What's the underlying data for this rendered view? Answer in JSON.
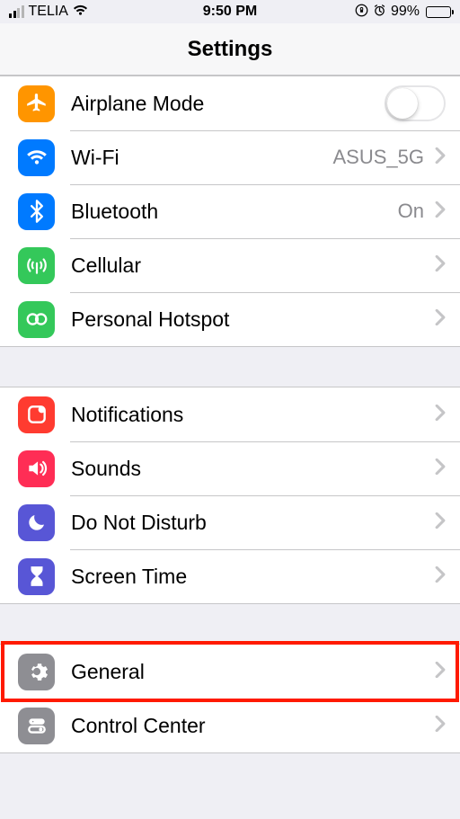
{
  "statusbar": {
    "carrier": "TELIA",
    "time": "9:50 PM",
    "battery_pct": "99%"
  },
  "header": {
    "title": "Settings"
  },
  "groups": [
    {
      "rows": [
        {
          "id": "airplane",
          "label": "Airplane Mode",
          "value": "",
          "toggle": true,
          "chevron": false
        },
        {
          "id": "wifi",
          "label": "Wi-Fi",
          "value": "ASUS_5G",
          "toggle": false,
          "chevron": true
        },
        {
          "id": "bluetooth",
          "label": "Bluetooth",
          "value": "On",
          "toggle": false,
          "chevron": true
        },
        {
          "id": "cellular",
          "label": "Cellular",
          "value": "",
          "toggle": false,
          "chevron": true
        },
        {
          "id": "hotspot",
          "label": "Personal Hotspot",
          "value": "",
          "toggle": false,
          "chevron": true
        }
      ]
    },
    {
      "rows": [
        {
          "id": "notifications",
          "label": "Notifications",
          "value": "",
          "toggle": false,
          "chevron": true
        },
        {
          "id": "sounds",
          "label": "Sounds",
          "value": "",
          "toggle": false,
          "chevron": true
        },
        {
          "id": "dnd",
          "label": "Do Not Disturb",
          "value": "",
          "toggle": false,
          "chevron": true
        },
        {
          "id": "screentime",
          "label": "Screen Time",
          "value": "",
          "toggle": false,
          "chevron": true
        }
      ]
    },
    {
      "rows": [
        {
          "id": "general",
          "label": "General",
          "value": "",
          "toggle": false,
          "chevron": true,
          "highlighted": true
        },
        {
          "id": "controlcenter",
          "label": "Control Center",
          "value": "",
          "toggle": false,
          "chevron": true
        }
      ]
    }
  ]
}
